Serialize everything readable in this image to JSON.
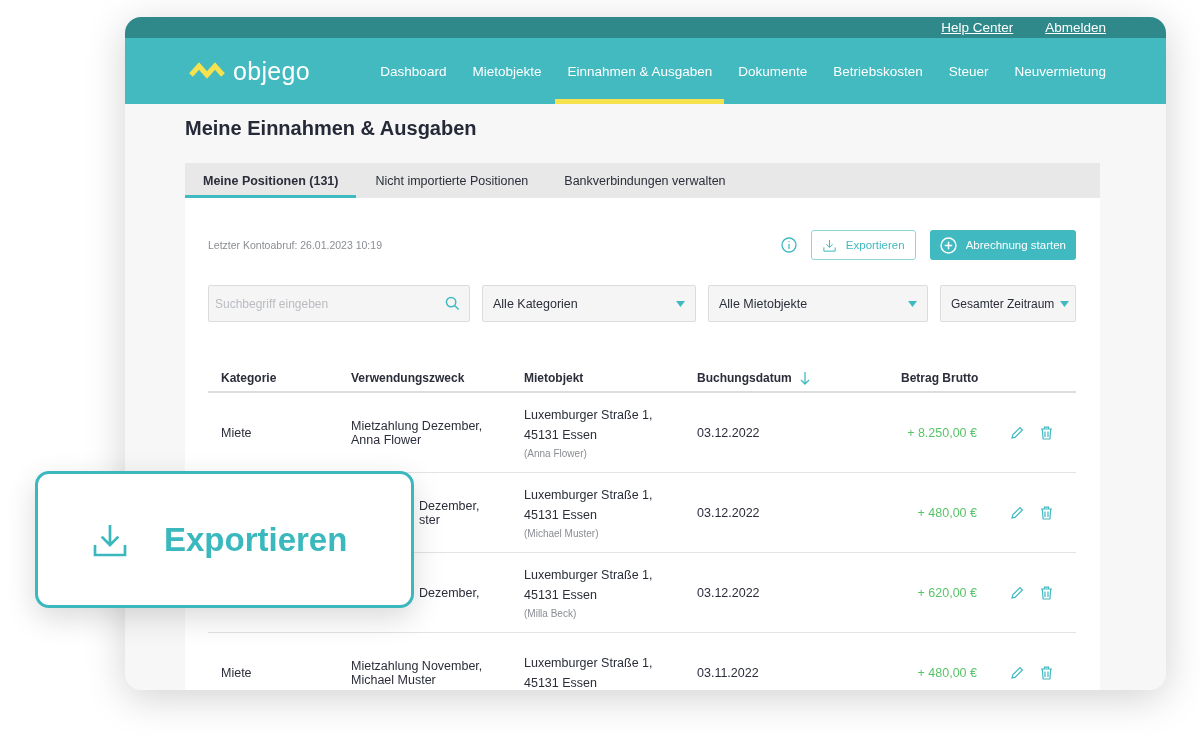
{
  "top_links": [
    "Help Center",
    "Abmelden"
  ],
  "logo": {
    "text": "objego"
  },
  "nav": [
    {
      "label": "Dashboard",
      "selected": false
    },
    {
      "label": "Mietobjekte",
      "selected": false
    },
    {
      "label": "Einnahmen & Ausgaben",
      "selected": true
    },
    {
      "label": "Dokumente",
      "selected": false
    },
    {
      "label": "Betriebskosten",
      "selected": false
    },
    {
      "label": "Steuer",
      "selected": false
    },
    {
      "label": "Neuvermietung",
      "selected": false
    }
  ],
  "page_title": "Meine Einnahmen & Ausgaben",
  "tabs": [
    {
      "label": "Meine Positionen (131)",
      "selected": true
    },
    {
      "label": "Nicht importierte Positionen",
      "selected": false
    },
    {
      "label": "Bankverbindungen verwalten",
      "selected": false
    }
  ],
  "last_fetch": "Letzter Kontoabruf: 26.01.2023 10:19",
  "actions": [
    {
      "kind": "info"
    },
    {
      "kind": "outline",
      "label": "Exportieren"
    },
    {
      "kind": "primary",
      "label": "Abrechnung starten"
    }
  ],
  "filters": [
    {
      "kind": "search",
      "placeholder": "Suchbegriff eingeben"
    },
    {
      "kind": "select",
      "value": "Alle Kategorien"
    },
    {
      "kind": "select",
      "value": "Alle Mietobjekte"
    },
    {
      "kind": "select",
      "value": "Gesamter Zeitraum"
    }
  ],
  "table": {
    "columns": [
      {
        "label": "Kategorie"
      },
      {
        "label": "Verwendungszweck"
      },
      {
        "label": "Mietobjekt"
      },
      {
        "label": "Buchungsdatum",
        "sorted": true
      },
      {
        "label": "Betrag Brutto"
      }
    ],
    "rows": [
      {
        "category": "Miete",
        "purpose": [
          "Mietzahlung Dezember,",
          "Anna Flower"
        ],
        "property": [
          "Luxemburger Straße 1,",
          "45131 Essen"
        ],
        "tenant": "(Anna Flower)",
        "date": "03.12.2022",
        "amount": "+ 8.250,00 €"
      },
      {
        "purpose": [
          "Dezember,",
          "ster"
        ],
        "property": [
          "Luxemburger Straße 1,",
          "45131 Essen"
        ],
        "tenant": "(Michael Muster)",
        "date": "03.12.2022",
        "amount": "+ 480,00 €"
      },
      {
        "purpose": [
          "Dezember,"
        ],
        "property": [
          "Luxemburger Straße 1,",
          "45131 Essen"
        ],
        "tenant": "(Milla Beck)",
        "date": "03.12.2022",
        "amount": "+ 620,00 €"
      },
      {
        "category": "Miete",
        "purpose": [
          "Mietzahlung November,",
          "Michael Muster"
        ],
        "property": [
          "Luxemburger Straße 1,",
          "45131 Essen"
        ],
        "date": "03.11.2022",
        "amount": "+ 480,00 €"
      }
    ]
  },
  "callout": {
    "label": "Exportieren"
  }
}
